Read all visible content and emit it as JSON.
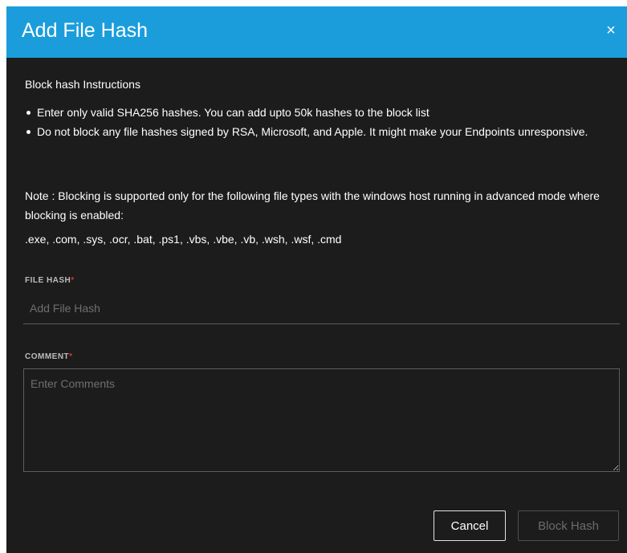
{
  "dialog": {
    "title": "Add File Hash",
    "close_glyph": "×"
  },
  "instructions": {
    "heading": "Block hash Instructions",
    "bullets": [
      "Enter only valid SHA256 hashes. You can add upto 50k hashes to the block list",
      "Do not block any file hashes signed by RSA, Microsoft, and Apple. It might make your Endpoints unresponsive."
    ],
    "note": "Note : Blocking is supported only for the following file types with the windows host running in advanced mode where blocking is enabled:",
    "file_types": ".exe, .com, .sys, .ocr, .bat, .ps1, .vbs, .vbe, .vb, .wsh, .wsf, .cmd"
  },
  "form": {
    "file_hash_label": "FILE HASH",
    "file_hash_placeholder": "Add File Hash",
    "file_hash_value": "",
    "comment_label": "COMMENT",
    "comment_placeholder": "Enter Comments",
    "comment_value": "",
    "required_marker": "*"
  },
  "buttons": {
    "cancel": "Cancel",
    "block_hash": "Block Hash"
  },
  "colors": {
    "header": "#1b9ddc",
    "dialog_bg": "#1c1c1c",
    "required": "#e0323a"
  }
}
